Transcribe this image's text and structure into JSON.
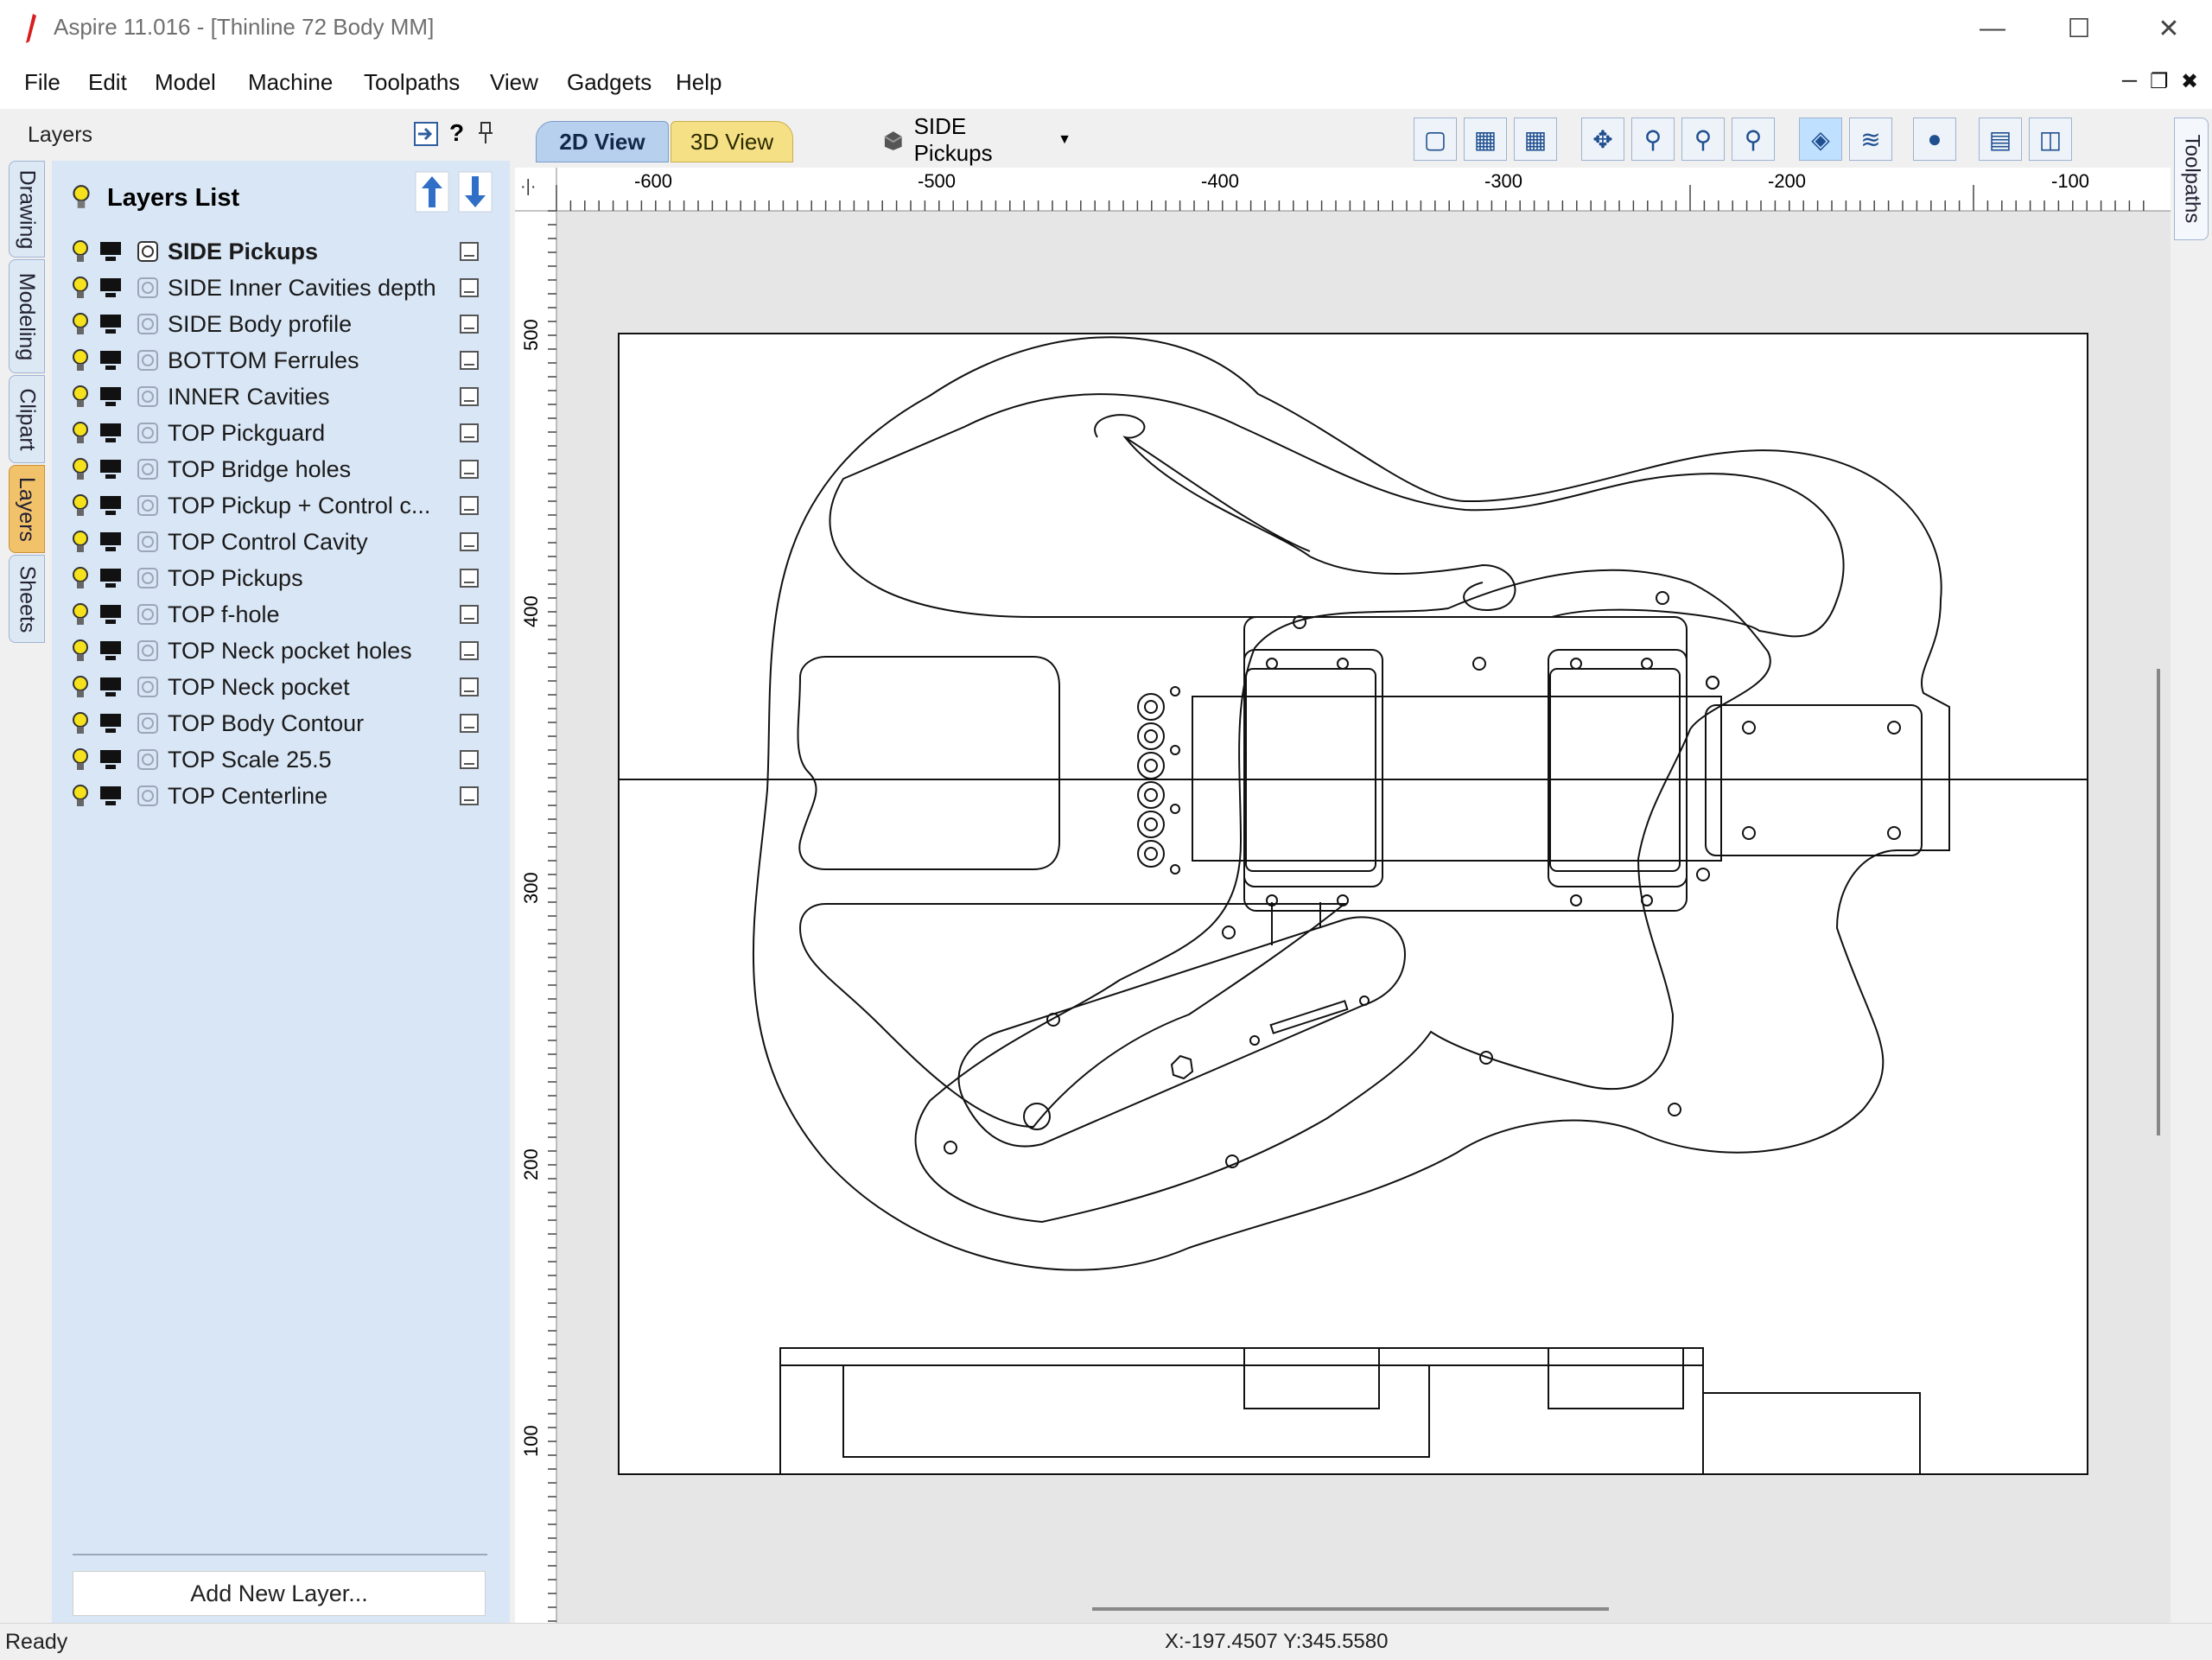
{
  "window": {
    "title": "Aspire 11.016 - [Thinline 72 Body MM]",
    "controls": [
      "minimize",
      "maximize",
      "close"
    ],
    "mdi_controls": [
      "minimize",
      "restore",
      "close"
    ]
  },
  "menu": [
    "File",
    "Edit",
    "Model",
    "Machine",
    "Toolpaths",
    "View",
    "Gadgets",
    "Help"
  ],
  "left_tabs": [
    "Drawing",
    "Modeling",
    "Clipart",
    "Layers",
    "Sheets"
  ],
  "active_left_tab": "Layers",
  "panel": {
    "title": "Layers",
    "help": "?",
    "list_title": "Layers List",
    "add_button": "Add New Layer..."
  },
  "layers": [
    {
      "name": "SIDE Pickups",
      "active": true
    },
    {
      "name": "SIDE Inner Cavities depth",
      "active": false
    },
    {
      "name": "SIDE Body profile",
      "active": false
    },
    {
      "name": "BOTTOM Ferrules",
      "active": false
    },
    {
      "name": "INNER Cavities",
      "active": false
    },
    {
      "name": "TOP Pickguard",
      "active": false
    },
    {
      "name": "TOP Bridge holes",
      "active": false
    },
    {
      "name": "TOP Pickup + Control c...",
      "active": false
    },
    {
      "name": "TOP Control Cavity",
      "active": false
    },
    {
      "name": "TOP Pickups",
      "active": false
    },
    {
      "name": "TOP f-hole",
      "active": false
    },
    {
      "name": "TOP Neck pocket holes",
      "active": false
    },
    {
      "name": "TOP Neck pocket",
      "active": false
    },
    {
      "name": "TOP Body Contour",
      "active": false
    },
    {
      "name": "TOP Scale 25.5",
      "active": false
    },
    {
      "name": "TOP Centerline",
      "active": false
    }
  ],
  "view_tabs": {
    "tab_2d": "2D View",
    "tab_3d": "3D View"
  },
  "current_layer": "SIDE Pickups",
  "right_tab": "Toolpaths",
  "ruler": {
    "h_labels": [
      "-600",
      "-500",
      "-400",
      "-300",
      "-200",
      "-100"
    ],
    "v_labels": [
      "500",
      "400",
      "300",
      "200",
      "100"
    ]
  },
  "status": {
    "text": "Ready",
    "coords": "X:-197.4507 Y:345.5580"
  },
  "toolbar_icons": [
    "fit-view-icon",
    "snap-icon",
    "grid-icon",
    "pan-icon",
    "zoom-in-icon",
    "zoom-extents-icon",
    "zoom-box-icon",
    "select-icon",
    "node-edit-icon",
    "render-icon",
    "layout-icon",
    "split-view-icon"
  ],
  "colors": {
    "panel_bg": "#d9e6f5",
    "active_tab": "#f2c26b",
    "tab_2d": "#b7d0ee",
    "tab_3d": "#f6e086",
    "drawing_bg": "#e6e6e6"
  }
}
